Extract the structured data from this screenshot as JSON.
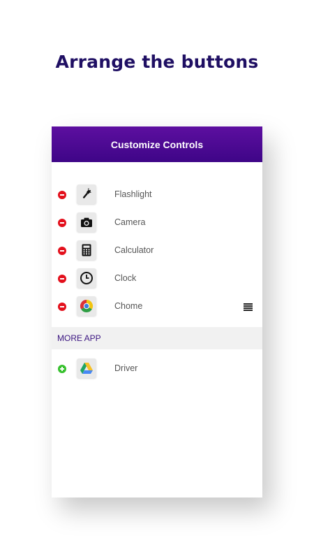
{
  "headline": "Arrange the buttons",
  "toolbar": {
    "title": "Customize Controls"
  },
  "controls": [
    {
      "label": "Flashlight",
      "icon": "flashlight-icon"
    },
    {
      "label": "Camera",
      "icon": "camera-icon"
    },
    {
      "label": "Calculator",
      "icon": "calculator-icon"
    },
    {
      "label": "Clock",
      "icon": "clock-icon"
    },
    {
      "label": "Chome",
      "icon": "chrome-icon"
    }
  ],
  "more_apps": {
    "title": "MORE APP",
    "items": [
      {
        "label": "Driver",
        "icon": "google-drive-icon"
      }
    ]
  },
  "colors": {
    "accent": "#4a0a92",
    "headline": "#1f0f63",
    "remove": "#e3101c",
    "add": "#37c12e"
  }
}
